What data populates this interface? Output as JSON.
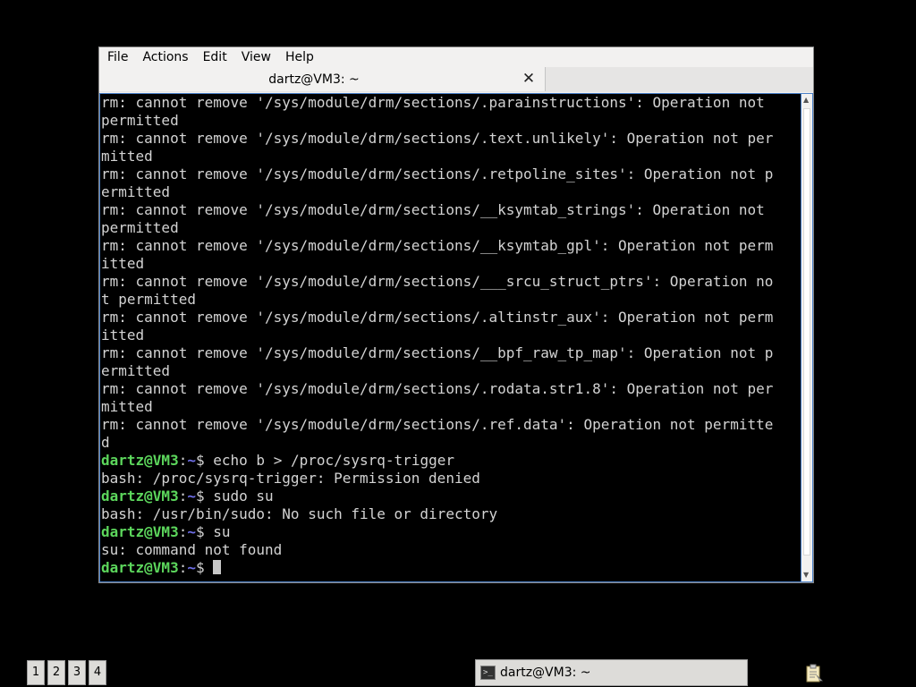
{
  "menubar": {
    "items": [
      "File",
      "Actions",
      "Edit",
      "View",
      "Help"
    ]
  },
  "tab": {
    "title": "dartz@VM3: ~",
    "close_glyph": "✕"
  },
  "terminal": {
    "output_lines": [
      "rm: cannot remove '/sys/module/drm/sections/.parainstructions': Operation not",
      "permitted",
      "rm: cannot remove '/sys/module/drm/sections/.text.unlikely': Operation not per",
      "mitted",
      "rm: cannot remove '/sys/module/drm/sections/.retpoline_sites': Operation not p",
      "ermitted",
      "rm: cannot remove '/sys/module/drm/sections/__ksymtab_strings': Operation not",
      "permitted",
      "rm: cannot remove '/sys/module/drm/sections/__ksymtab_gpl': Operation not perm",
      "itted",
      "rm: cannot remove '/sys/module/drm/sections/___srcu_struct_ptrs': Operation no",
      "t permitted",
      "rm: cannot remove '/sys/module/drm/sections/.altinstr_aux': Operation not perm",
      "itted",
      "rm: cannot remove '/sys/module/drm/sections/__bpf_raw_tp_map': Operation not p",
      "ermitted",
      "rm: cannot remove '/sys/module/drm/sections/.rodata.str1.8': Operation not per",
      "mitted",
      "rm: cannot remove '/sys/module/drm/sections/.ref.data': Operation not permitte",
      "d"
    ],
    "session": [
      {
        "type": "prompt",
        "user": "dartz@VM3",
        "path": "~",
        "symbol": "$",
        "command": " echo b > /proc/sysrq-trigger"
      },
      {
        "type": "output",
        "text": "bash: /proc/sysrq-trigger: Permission denied"
      },
      {
        "type": "prompt",
        "user": "dartz@VM3",
        "path": "~",
        "symbol": "$",
        "command": " sudo su"
      },
      {
        "type": "output",
        "text": "bash: /usr/bin/sudo: No such file or directory"
      },
      {
        "type": "prompt",
        "user": "dartz@VM3",
        "path": "~",
        "symbol": "$",
        "command": " su"
      },
      {
        "type": "output",
        "text": "su: command not found"
      },
      {
        "type": "prompt",
        "user": "dartz@VM3",
        "path": "~",
        "symbol": "$",
        "command": " ",
        "cursor": true
      }
    ],
    "colors": {
      "user": "#5cd65c",
      "path": "#6e6ee8",
      "text": "#d3d3d3",
      "background": "#000000"
    }
  },
  "taskbar": {
    "workspaces": [
      "1",
      "2",
      "3",
      "4"
    ],
    "task_label": "dartz@VM3: ~",
    "task_icon": "terminal-icon",
    "tray_icon": "clipboard-icon"
  }
}
